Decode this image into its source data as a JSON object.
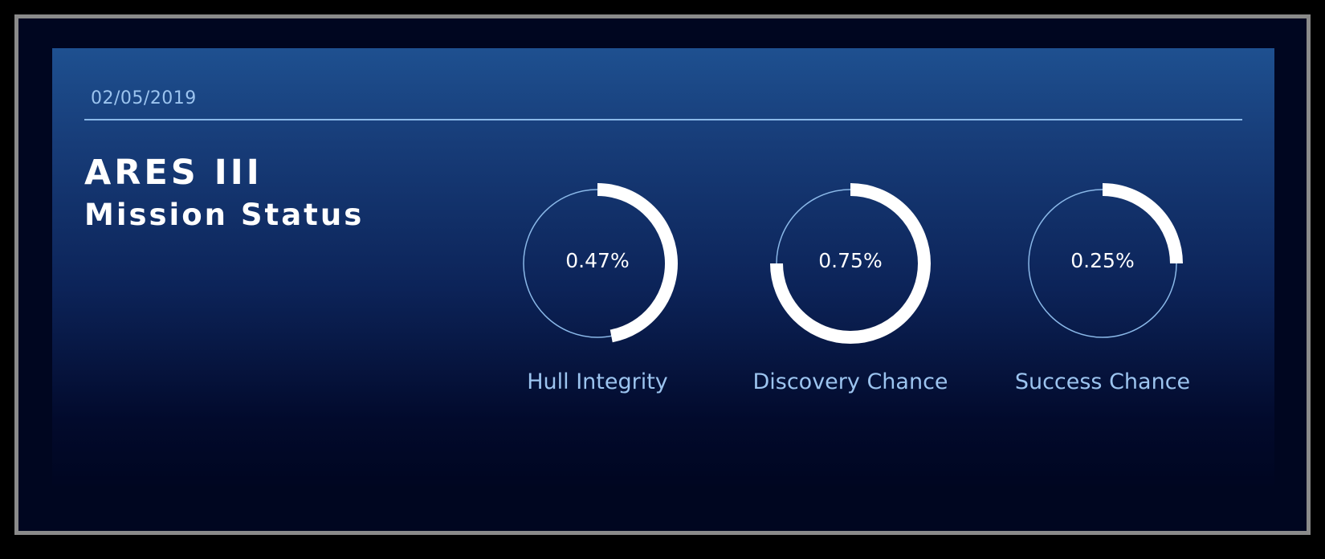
{
  "header": {
    "date": "02/05/2019"
  },
  "title": {
    "main": "ARES III",
    "sub": "Mission Status"
  },
  "gauges": [
    {
      "value_text": "0.47%",
      "label": "Hull Integrity",
      "fraction": 0.47
    },
    {
      "value_text": "0.75%",
      "label": "Discovery Chance",
      "fraction": 0.75
    },
    {
      "value_text": "0.25%",
      "label": "Success Chance",
      "fraction": 0.25
    }
  ],
  "colors": {
    "background": "#000000",
    "frame_border": "#8a8a8a",
    "panel_top": "#1e5090",
    "panel_bottom": "#000621",
    "accent_text": "#9cc4ef",
    "ring_track": "#8ab8e8",
    "ring_fill": "#ffffff"
  }
}
